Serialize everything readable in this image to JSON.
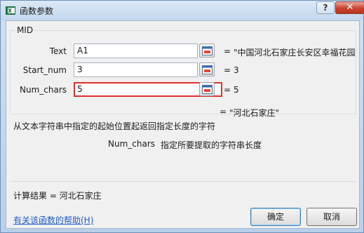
{
  "window": {
    "title": "函数参数",
    "help_button": "?",
    "close_button": "✕"
  },
  "function": {
    "name": "MID"
  },
  "arguments": [
    {
      "label": "Text",
      "value": "A1",
      "result": "\"中国河北石家庄长安区幸福花园小"
    },
    {
      "label": "Start_num",
      "value": "3",
      "result": "3"
    },
    {
      "label": "Num_chars",
      "value": "5",
      "result": "5"
    }
  ],
  "equals": "=",
  "function_result": "\"河北石家庄\"",
  "description": "从文本字符串中指定的起始位置起返回指定长度的字符",
  "param_help": {
    "name": "Num_chars",
    "text": "指定所要提取的字符串长度"
  },
  "calc_result": "计算结果 =  河北石家庄",
  "help_link": "有关该函数的帮助(H)",
  "buttons": {
    "ok": "确定",
    "cancel": "取消"
  },
  "colors": {
    "active_border": "#e03030",
    "link": "#1f5bc6"
  }
}
